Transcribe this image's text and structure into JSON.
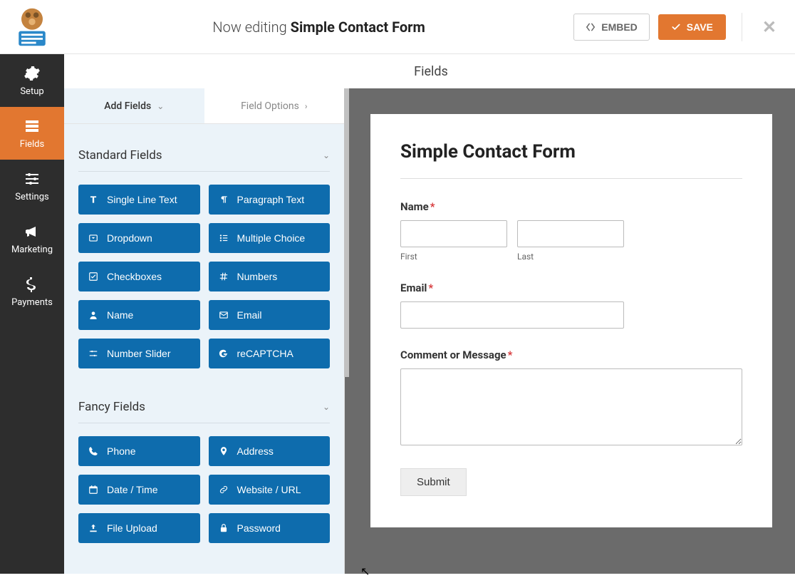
{
  "header": {
    "editing_prefix": "Now editing",
    "form_name": "Simple Contact Form",
    "embed_label": "EMBED",
    "save_label": "SAVE"
  },
  "subheader": {
    "label": "Fields"
  },
  "left_nav": {
    "items": [
      {
        "label": "Setup"
      },
      {
        "label": "Fields"
      },
      {
        "label": "Settings"
      },
      {
        "label": "Marketing"
      },
      {
        "label": "Payments"
      }
    ]
  },
  "panel_tabs": {
    "add_fields": "Add Fields",
    "field_options": "Field Options"
  },
  "sections": {
    "standard": {
      "title": "Standard Fields",
      "fields": [
        "Single Line Text",
        "Paragraph Text",
        "Dropdown",
        "Multiple Choice",
        "Checkboxes",
        "Numbers",
        "Name",
        "Email",
        "Number Slider",
        "reCAPTCHA"
      ]
    },
    "fancy": {
      "title": "Fancy Fields",
      "fields": [
        "Phone",
        "Address",
        "Date / Time",
        "Website / URL",
        "File Upload",
        "Password"
      ]
    }
  },
  "form_preview": {
    "title": "Simple Contact Form",
    "name_label": "Name",
    "first_sub": "First",
    "last_sub": "Last",
    "email_label": "Email",
    "comment_label": "Comment or Message",
    "submit_label": "Submit"
  }
}
